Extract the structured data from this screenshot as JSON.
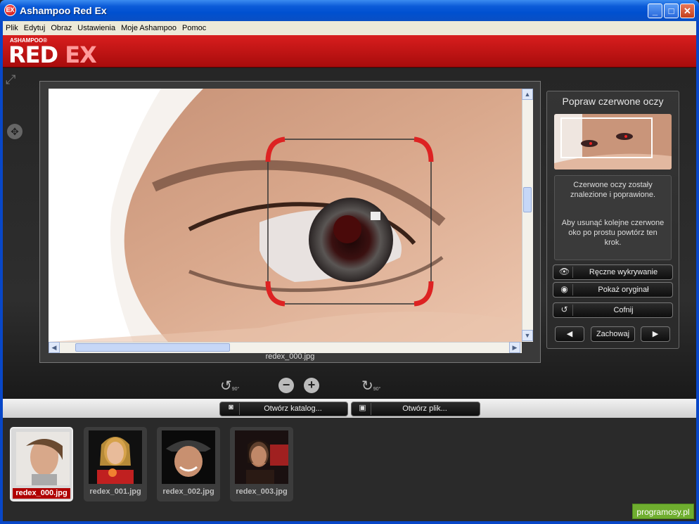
{
  "window": {
    "title": "Ashampoo Red Ex",
    "app_icon": "EX"
  },
  "menu": [
    "Plik",
    "Edytuj",
    "Obraz",
    "Ustawienia",
    "Moje Ashampoo",
    "Pomoc"
  ],
  "brand": {
    "small": "ASHAMPOO®",
    "name_red": "RED ",
    "name_ex": "EX",
    "color": "#c41414"
  },
  "viewer": {
    "filename": "redex_000.jpg"
  },
  "panel": {
    "title": "Popraw czerwone oczy",
    "info_line1": "Czerwone oczy zostały znalezione i poprawione.",
    "info_line2": "Aby usunąć kolejne czerwone oko po prostu powtórz ten krok.",
    "buttons": {
      "manual": "Ręczne wykrywanie",
      "original": "Pokaż oryginał",
      "undo": "Cofnij",
      "save": "Zachowaj"
    }
  },
  "toolbar": {
    "rotate_left": "90°",
    "rotate_right": "90°"
  },
  "open": {
    "folder": "Otwórz katalog...",
    "file": "Otwórz plik..."
  },
  "thumbnails": [
    {
      "name": "redex_000.jpg"
    },
    {
      "name": "redex_001.jpg"
    },
    {
      "name": "redex_002.jpg"
    },
    {
      "name": "redex_003.jpg"
    }
  ],
  "badge": "programosy.pl"
}
